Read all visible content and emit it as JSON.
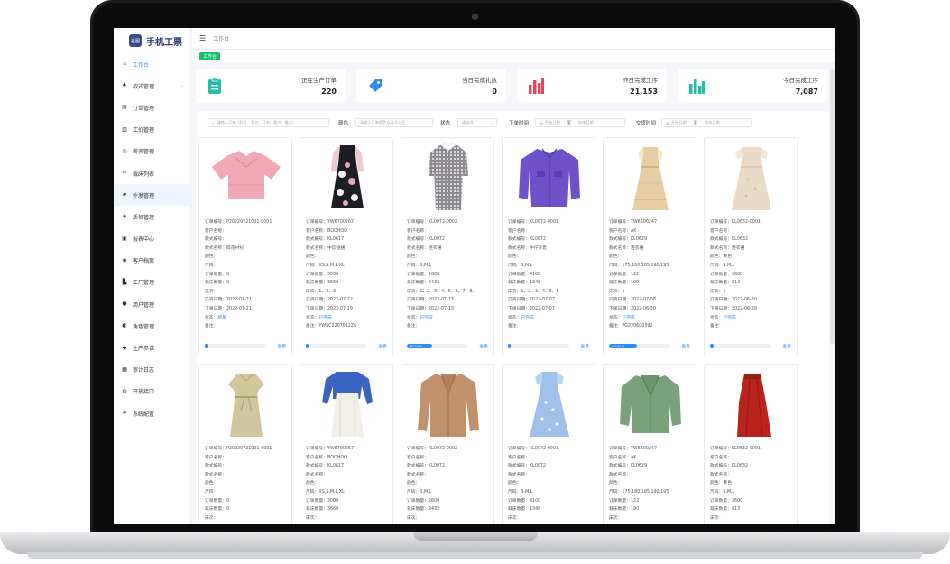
{
  "app": {
    "logo_badge": "名图",
    "logo_text": "手机工票"
  },
  "sidebar": {
    "items": [
      {
        "label": "工作台",
        "icon": "home-icon",
        "active": true
      },
      {
        "label": "款式管理",
        "icon": "shirt-icon",
        "expandable": true
      },
      {
        "label": "订单管理",
        "icon": "order-icon"
      },
      {
        "label": "工价管理",
        "icon": "price-icon"
      },
      {
        "label": "薪资管理",
        "icon": "salary-icon"
      },
      {
        "label": "裁床列表",
        "icon": "cut-icon"
      },
      {
        "label": "外发管理",
        "icon": "truck-icon",
        "highlight": true
      },
      {
        "label": "质检管理",
        "icon": "shield-icon"
      },
      {
        "label": "报表中心",
        "icon": "report-icon"
      },
      {
        "label": "客户档案",
        "icon": "customer-icon"
      },
      {
        "label": "工厂管理",
        "icon": "factory-icon"
      },
      {
        "label": "用户管理",
        "icon": "user-icon"
      },
      {
        "label": "角色管理",
        "icon": "role-icon"
      },
      {
        "label": "生产参谋",
        "icon": "staff-icon"
      },
      {
        "label": "审计日志",
        "icon": "log-icon"
      },
      {
        "label": "开放接口",
        "icon": "api-icon"
      },
      {
        "label": "系统配置",
        "icon": "gear-icon"
      }
    ]
  },
  "topbar": {
    "breadcrumb": "工作台"
  },
  "tabs": {
    "active": "工作台"
  },
  "colors": {
    "accent": "#2d8cf0",
    "teal": "#1fbfa8",
    "red": "#e64560",
    "green": "#19be6b",
    "navy": "#2d3870"
  },
  "stats": [
    {
      "label": "正在生产订单",
      "value": "220",
      "icon": "clipboard-icon"
    },
    {
      "label": "当日完成扎数",
      "value": "0",
      "icon": "tag-icon"
    },
    {
      "label": "昨日完成工序",
      "value": "21,153",
      "icon": "bar-chart-red-icon"
    },
    {
      "label": "今日完成工序",
      "value": "7,087",
      "icon": "bar-chart-teal-icon"
    }
  ],
  "filters": {
    "search_placeholder": "请输入订单（款号、款名、订单、客户、备注）",
    "color_label": "颜色",
    "color_placeholder": "请输入订单颜色以逗号分开",
    "status_label": "状态",
    "status_value": "请选择",
    "order_time_label": "下单时间",
    "order_time_start": "开始日期",
    "order_time_end": "结束日期",
    "delivery_time_label": "交货时间",
    "delivery_time_start": "开始日期",
    "delivery_time_end": "结束日期",
    "range_sep": "至"
  },
  "field_labels": {
    "order_no": "订单编号：",
    "customer": "客户名称：",
    "style_no": "款式编号：",
    "style_name": "款式名称：",
    "color": "颜色：",
    "size": "尺码：",
    "order_qty": "订单数量：",
    "cut_qty": "裁床数量：",
    "bed_count": "床次：",
    "delivery_date": "交货日期：",
    "order_date": "下单日期：",
    "status": "状态：",
    "remark": "备注："
  },
  "card_action": "查看",
  "orders": [
    {
      "order_no": "P20220721001-0001",
      "customer": "",
      "style_no": "",
      "style_name": "碎花衬衫",
      "color": "",
      "size": "",
      "order_qty": "0",
      "cut_qty": "0",
      "bed_count": "",
      "delivery_date": "2022-07-21",
      "order_date": "2022-07-21",
      "status": "新单",
      "remark": "",
      "progress": 0,
      "progress_label": "",
      "image": "pink-blouse"
    },
    {
      "order_no": "YW6700267",
      "customer": "BOOHOO",
      "style_no": "KL0617",
      "style_name": "中印短裙",
      "color": "",
      "size": "XS,S,M,L,XL",
      "order_qty": "3000",
      "cut_qty": "3660",
      "bed_count": "1、2、3",
      "delivery_date": "2022-07-22",
      "order_date": "2022-07-19",
      "status": "已完成",
      "remark": "YWSC2207012Z6",
      "progress": 0,
      "progress_label": "",
      "image": "floral-dress"
    },
    {
      "order_no": "KL0072-0002",
      "customer": "",
      "style_no": "KL0072",
      "style_name": "连衣裙",
      "color": "",
      "size": "S,M,L",
      "order_qty": "2600",
      "cut_qty": "2432",
      "bed_count": "1、2、3、4、5、6、7、8、",
      "delivery_date": "2022-07-13",
      "order_date": "2022-07-13",
      "status": "已完成",
      "remark": "",
      "progress": 40.58,
      "progress_label": "40.58%",
      "image": "plaid-dress"
    },
    {
      "order_no": "KL0072-0001",
      "customer": "",
      "style_no": "KL0072",
      "style_name": "牛仔外套",
      "color": "",
      "size": "S,M,L",
      "order_qty": "4100",
      "cut_qty": "1348",
      "bed_count": "1、2、3、4、5、6",
      "delivery_date": "2022-07-07",
      "order_date": "2022-07-07",
      "status": "已完成",
      "remark": "",
      "progress": 0,
      "progress_label": "",
      "image": "purple-jacket"
    },
    {
      "order_no": "YW6600247",
      "customer": "AK",
      "style_no": "KL0629",
      "style_name": "连衣裙",
      "color": "",
      "size": "175,180,185,190,195",
      "order_qty": "122",
      "cut_qty": "190",
      "bed_count": "1",
      "delivery_date": "2022-07-08",
      "order_date": "2022-06-30",
      "status": "已完成",
      "remark": "PG220600392",
      "progress": 45.91,
      "progress_label": "45.91%",
      "image": "beige-dress"
    },
    {
      "order_no": "KL0632-0001",
      "customer": "",
      "style_no": "KL0632",
      "style_name": "连衣裙",
      "color": "黄色",
      "size": "S,M,L",
      "order_qty": "3600",
      "cut_qty": "813",
      "bed_count": "1",
      "delivery_date": "2022-06-30",
      "order_date": "2022-06-29",
      "status": "已完成",
      "remark": "",
      "progress": 1,
      "progress_label": "",
      "image": "cream-dress"
    },
    {
      "order_no": "P20220721001-0001",
      "customer": "",
      "style_no": "",
      "style_name": "",
      "color": "",
      "size": "",
      "order_qty": "0",
      "cut_qty": "0",
      "bed_count": "",
      "image": "khaki-dress"
    },
    {
      "order_no": "YW6700267",
      "customer": "BOOHOO",
      "style_no": "KL0617",
      "style_name": "",
      "color": "",
      "size": "XS,S,M,L,XL",
      "order_qty": "3000",
      "cut_qty": "3660",
      "bed_count": "",
      "image": "layered-dress"
    },
    {
      "order_no": "KL0072-0002",
      "customer": "",
      "style_no": "KL0072",
      "style_name": "",
      "color": "",
      "size": "S,M,L",
      "order_qty": "2600",
      "cut_qty": "2432",
      "bed_count": "",
      "image": "camel-coat"
    },
    {
      "order_no": "KL0072-0001",
      "customer": "",
      "style_no": "KL0072",
      "style_name": "",
      "color": "",
      "size": "S,M,L",
      "order_qty": "4100",
      "cut_qty": "1348",
      "bed_count": "",
      "image": "blue-dress"
    },
    {
      "order_no": "YW6600247",
      "customer": "AK",
      "style_no": "KL0629",
      "style_name": "",
      "color": "",
      "size": "175,180,185,190,195",
      "order_qty": "122",
      "cut_qty": "190",
      "bed_count": "",
      "image": "green-jacket"
    },
    {
      "order_no": "KL0632-0001",
      "customer": "",
      "style_no": "KL0632",
      "style_name": "",
      "color": "黄色",
      "size": "S,M,L",
      "order_qty": "3600",
      "cut_qty": "813",
      "bed_count": "",
      "image": "red-skirt"
    }
  ]
}
